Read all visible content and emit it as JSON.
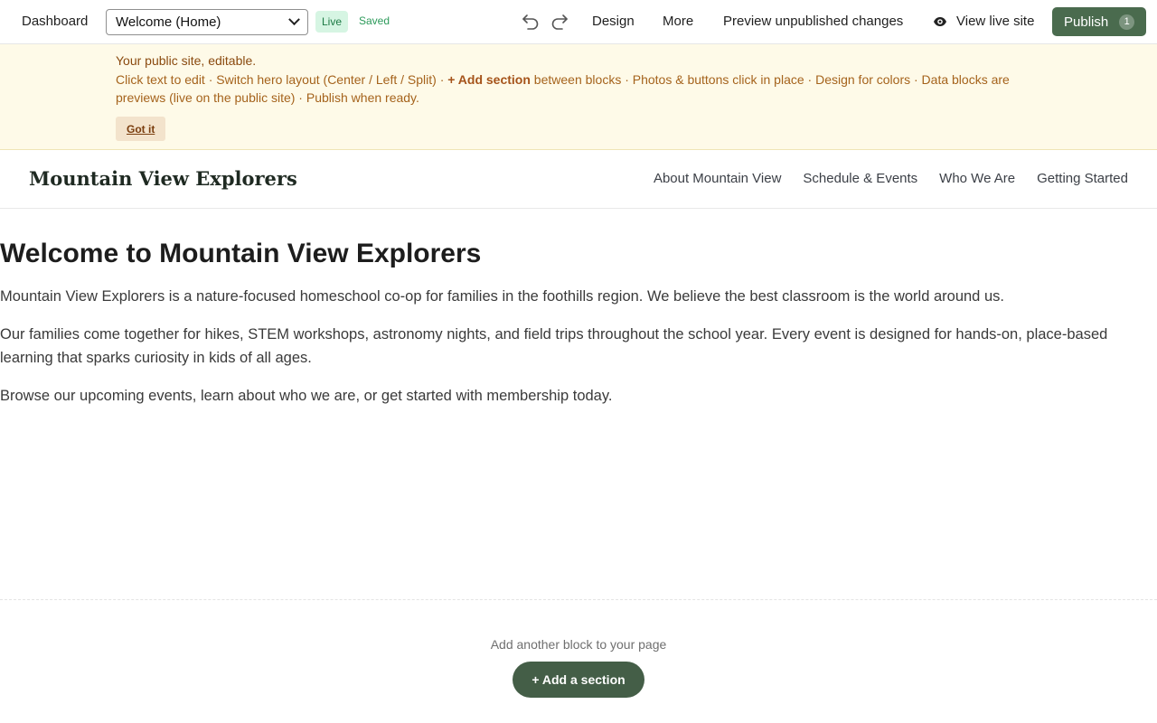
{
  "toolbar": {
    "dashboard_label": "Dashboard",
    "page_select_value": "Welcome (Home)",
    "live_badge": "Live",
    "saved_status": "Saved",
    "undo_icon": "undo-icon",
    "redo_icon": "redo-icon",
    "design_label": "Design",
    "more_label": "More",
    "preview_label": "Preview unpublished changes",
    "view_live_label": "View live site",
    "publish_label": "Publish",
    "publish_count": "1"
  },
  "banner": {
    "title": "Your public site, editable.",
    "text_before": "Click text to edit · Switch hero layout (Center / Left / Split) · ",
    "text_bold": "+ Add section",
    "text_after": " between blocks · Photos & buttons click in place · Design for colors · Data blocks are previews (live on the public site) · Publish when ready.",
    "dismiss_label": "Got it"
  },
  "site": {
    "title": "Mountain View Explorers",
    "nav": [
      {
        "label": "About Mountain View"
      },
      {
        "label": "Schedule & Events"
      },
      {
        "label": "Who We Are"
      },
      {
        "label": "Getting Started"
      }
    ]
  },
  "content": {
    "heading": "Welcome to Mountain View Explorers",
    "paragraphs": [
      "Mountain View Explorers is a nature-focused homeschool co-op for families in the foothills region. We believe the best classroom is the world around us.",
      "Our families come together for hikes, STEM workshops, astronomy nights, and field trips throughout the school year. Every event is designed for hands-on, place-based learning that sparks curiosity in kids of all ages.",
      "Browse our upcoming events, learn about who we are, or get started with membership today."
    ]
  },
  "footer_add": {
    "hint": "Add another block to your page",
    "button_label": "+ Add a section"
  },
  "colors": {
    "publish_bg": "#4a6b4e",
    "banner_bg": "#fefae8",
    "live_badge_bg": "#d6f5e3",
    "add_button_bg": "#445e47"
  }
}
